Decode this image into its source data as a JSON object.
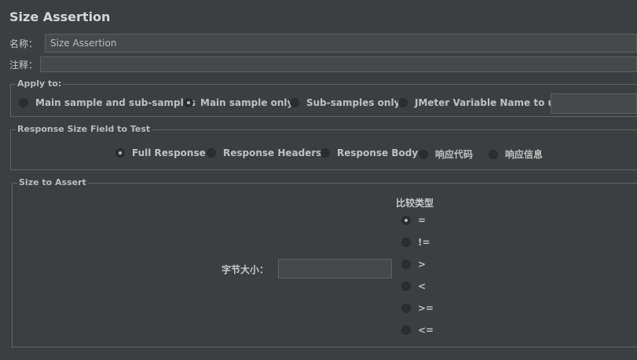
{
  "title": "Size Assertion",
  "name_label": "名称：",
  "name_value": "Size Assertion",
  "comment_label": "注释：",
  "comment_value": "",
  "apply_to": {
    "legend": "Apply to:",
    "options": [
      {
        "label": "Main sample and sub-samples",
        "checked": false
      },
      {
        "label": "Main sample only",
        "checked": true
      },
      {
        "label": "Sub-samples only",
        "checked": false
      },
      {
        "label": "JMeter Variable Name to use",
        "checked": false
      }
    ],
    "variable_value": ""
  },
  "response_field": {
    "legend": "Response Size Field to Test",
    "options": [
      {
        "label": "Full Response",
        "checked": true
      },
      {
        "label": "Response Headers",
        "checked": false
      },
      {
        "label": "Response Body",
        "checked": false
      },
      {
        "label": "响应代码",
        "checked": false
      },
      {
        "label": "响应信息",
        "checked": false
      }
    ]
  },
  "size_to_assert": {
    "legend": "Size to Assert",
    "size_label": "字节大小：",
    "size_value": "",
    "compare_label": "比较类型",
    "operators": [
      {
        "label": "=",
        "checked": true
      },
      {
        "label": "!=",
        "checked": false
      },
      {
        "label": ">",
        "checked": false
      },
      {
        "label": "<",
        "checked": false
      },
      {
        "label": ">=",
        "checked": false
      },
      {
        "label": "<=",
        "checked": false
      }
    ]
  }
}
